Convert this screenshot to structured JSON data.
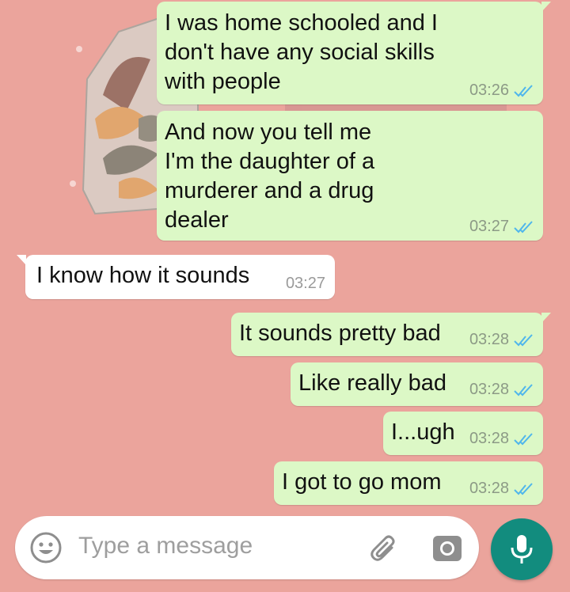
{
  "messages": [
    {
      "dir": "out",
      "text": "I was home schooled and I\ndon't have any social skills\nwith people",
      "time": "03:26",
      "status": "read"
    },
    {
      "dir": "out",
      "text": "And now you tell me\nI'm the daughter of a\nmurderer and a drug\ndealer",
      "time": "03:27",
      "status": "read"
    },
    {
      "dir": "in",
      "text": "I know how it sounds",
      "time": "03:27"
    },
    {
      "dir": "out",
      "text": "It sounds pretty bad",
      "time": "03:28",
      "status": "read"
    },
    {
      "dir": "out",
      "text": "Like really bad",
      "time": "03:28",
      "status": "read"
    },
    {
      "dir": "out",
      "text": "I...ugh",
      "time": "03:28",
      "status": "read"
    },
    {
      "dir": "out",
      "text": "I got to go mom",
      "time": "03:28",
      "status": "read"
    }
  ],
  "composer": {
    "placeholder": "Type a message",
    "emoji_icon": "emoji-icon",
    "attach_icon": "paperclip-icon",
    "camera_icon": "camera-icon",
    "mic_icon": "mic-icon"
  },
  "colors": {
    "wallpaper": "#eba49c",
    "outgoing_bubble": "#dcf8c6",
    "incoming_bubble": "#ffffff",
    "read_ticks": "#4fb6ec",
    "mic_button": "#128c7e"
  }
}
